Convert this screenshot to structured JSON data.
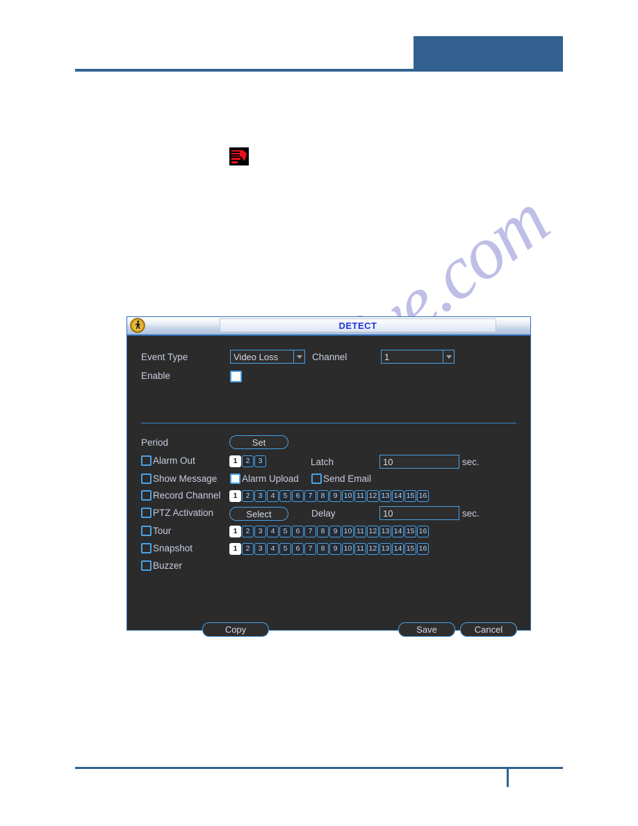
{
  "document": {
    "logo_icon": "red-arrow-logo-icon",
    "watermark_text": "manualshive.com",
    "header_block_color": "#32618f",
    "rule_color": "#32618f"
  },
  "dialog": {
    "title": "DETECT",
    "title_icon": "walking-person-icon",
    "accent_color": "#4aa3e8",
    "background_color": "#2b2b2b",
    "title_text_color": "#1d34d8",
    "fields": {
      "event_type_label": "Event Type",
      "event_type_value": "Video Loss",
      "channel_label": "Channel",
      "channel_value": "1",
      "enable_label": "Enable",
      "enable_checked": true,
      "period_label": "Period",
      "period_button": "Set",
      "alarm_out_label": "Alarm Out",
      "alarm_out_checked": false,
      "latch_label": "Latch",
      "latch_value": "10",
      "latch_unit": "sec.",
      "show_message_label": "Show Message",
      "show_message_checked": false,
      "alarm_upload_label": "Alarm Upload",
      "alarm_upload_checked": true,
      "send_email_label": "Send Email",
      "send_email_checked": false,
      "record_channel_label": "Record Channel",
      "record_channel_checked": false,
      "ptz_activation_label": "PTZ Activation",
      "ptz_activation_checked": false,
      "ptz_button": "Select",
      "delay_label": "Delay",
      "delay_value": "10",
      "delay_unit": "sec.",
      "tour_label": "Tour",
      "tour_checked": false,
      "snapshot_label": "Snapshot",
      "snapshot_checked": false,
      "buzzer_label": "Buzzer",
      "buzzer_checked": false
    },
    "channel_chips": {
      "alarm_out": [
        "1",
        "2",
        "3"
      ],
      "alarm_out_selected": [
        "1"
      ],
      "sixteen": [
        "1",
        "2",
        "3",
        "4",
        "5",
        "6",
        "7",
        "8",
        "9",
        "10",
        "11",
        "12",
        "13",
        "14",
        "15",
        "16"
      ],
      "sixteen_selected": [
        "1"
      ]
    },
    "buttons": {
      "copy": "Copy",
      "save": "Save",
      "cancel": "Cancel"
    }
  }
}
